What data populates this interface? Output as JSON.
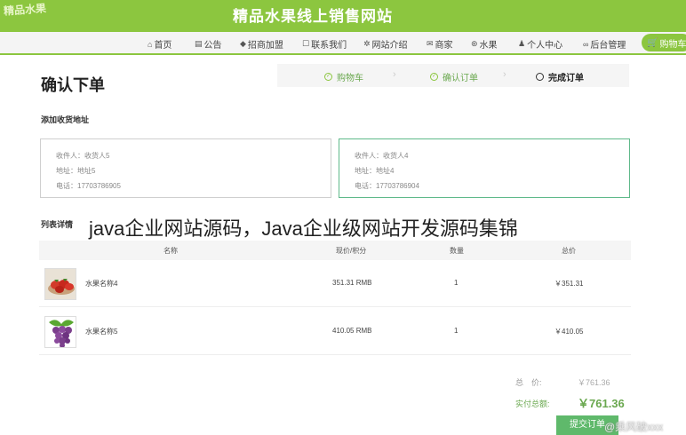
{
  "header": {
    "logo_text": "精品水果",
    "site_title": "精品水果线上销售网站"
  },
  "nav": {
    "items": [
      {
        "label": "首页",
        "icon": "home-icon",
        "glyph": "⌂"
      },
      {
        "label": "公告",
        "icon": "notice-icon",
        "glyph": "▤"
      },
      {
        "label": "招商加盟",
        "icon": "layers-icon",
        "glyph": "◆"
      },
      {
        "label": "联系我们",
        "icon": "contact-icon",
        "glyph": "☐"
      },
      {
        "label": "网站介绍",
        "icon": "gear-icon",
        "glyph": "✲"
      },
      {
        "label": "商家",
        "icon": "mail-icon",
        "glyph": "✉"
      },
      {
        "label": "水果",
        "icon": "fruit-icon",
        "glyph": "⊛"
      },
      {
        "label": "个人中心",
        "icon": "user-icon",
        "glyph": "♟"
      },
      {
        "label": "后台管理",
        "icon": "link-icon",
        "glyph": "∞"
      }
    ],
    "cart_label": "购物车"
  },
  "page": {
    "title": "确认下单",
    "address_section": "添加收货地址",
    "list_section": "列表详情",
    "watermark": "java企业网站源码，Java企业级网站开发源码集锦"
  },
  "steps": [
    {
      "label": "购物车",
      "state": "done"
    },
    {
      "label": "确认订单",
      "state": "done"
    },
    {
      "label": "完成订单",
      "state": "current"
    }
  ],
  "addresses": [
    {
      "recipient": "收件人：收货人5",
      "address": "地址：地址5",
      "phone": "电话：17703786905",
      "selected": false
    },
    {
      "recipient": "收件人：收货人4",
      "address": "地址：地址4",
      "phone": "电话：17703786904",
      "selected": true
    }
  ],
  "table": {
    "headers": {
      "name": "名称",
      "price": "现价/积分",
      "qty": "数量",
      "total": "总价"
    },
    "rows": [
      {
        "name": "水果名称4",
        "price": "351.31 RMB",
        "qty": "1",
        "total": "￥351.31",
        "image": "strawberry-thumbnail"
      },
      {
        "name": "水果名称5",
        "price": "410.05 RMB",
        "qty": "1",
        "total": "￥410.05",
        "image": "grape-thumbnail"
      }
    ]
  },
  "summary": {
    "total_label": "总　价:",
    "total_value": "￥761.36",
    "pay_label": "实付总额:",
    "pay_value": "￥761.36",
    "submit_label": "提交订单"
  },
  "credit": "@乘风破xxx",
  "colors": {
    "brand": "#8cc63f",
    "accent": "#6aa84f",
    "selected_border": "#5fb98a"
  }
}
